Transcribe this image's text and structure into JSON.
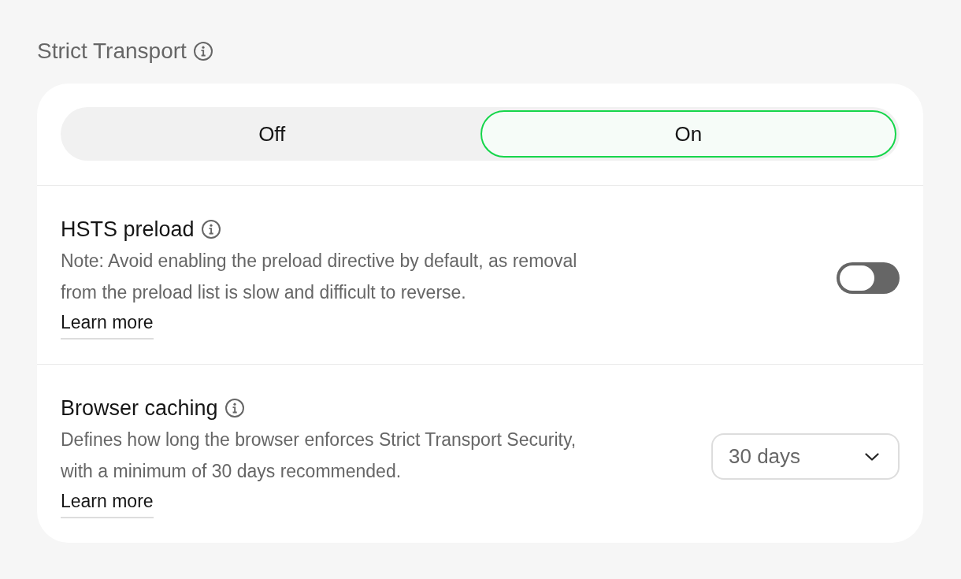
{
  "section": {
    "title": "Strict Transport"
  },
  "mode_switch": {
    "options": [
      {
        "label": "Off",
        "selected": false
      },
      {
        "label": "On",
        "selected": true
      }
    ]
  },
  "settings": [
    {
      "kind": "toggle",
      "title": "HSTS preload",
      "description": "Note: Avoid enabling the preload directive by default, as removal from the preload list is slow and difficult to reverse.",
      "link": "Learn more",
      "on": false
    },
    {
      "kind": "select",
      "title": "Browser caching",
      "description": "Defines how long the browser enforces Strict Transport Security, with a minimum of 30 days recommended.",
      "link": "Learn more",
      "value": "30 days"
    }
  ]
}
